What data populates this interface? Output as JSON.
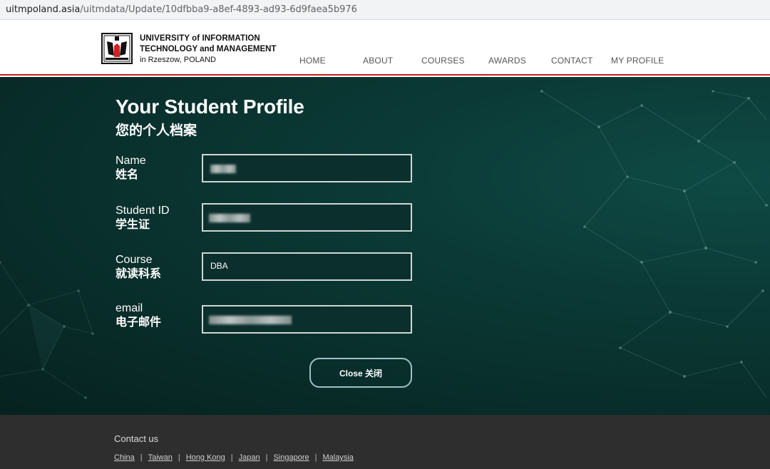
{
  "browser": {
    "url_host": "uitmpoland.asia",
    "url_path": "/uitmdata/Update/10dfbba9-a8ef-4893-ad93-6d9faea5b976"
  },
  "header": {
    "logo_line1": "UNIVERSITY of INFORMATION",
    "logo_line2": "TECHNOLOGY and MANAGEMENT",
    "logo_line3": "in Rzeszow, POLAND",
    "logo_icon": "university-crest-icon",
    "nav": [
      "HOME",
      "ABOUT",
      "COURSES",
      "AWARDS",
      "CONTACT",
      "MY PROFILE"
    ]
  },
  "profile": {
    "title": "Your Student Profile",
    "subtitle": "您的个人档案",
    "fields": [
      {
        "label_en": "Name",
        "label_zh": "姓名",
        "value": ""
      },
      {
        "label_en": "Student ID",
        "label_zh": "学生证",
        "value": ""
      },
      {
        "label_en": "Course",
        "label_zh": "就读科系",
        "value": "DBA"
      },
      {
        "label_en": "email",
        "label_zh": "电子邮件",
        "value": ""
      }
    ],
    "close_button": "Close 关闭"
  },
  "footer": {
    "contact_heading": "Contact us",
    "links": [
      "China",
      "Taiwan",
      "Hong Kong",
      "Japan",
      "Singapore",
      "Malaysia"
    ]
  },
  "colors": {
    "main_bg": "#0b3a36",
    "header_accent": "#c61f1f",
    "footer_bg": "#2e2e2e"
  }
}
